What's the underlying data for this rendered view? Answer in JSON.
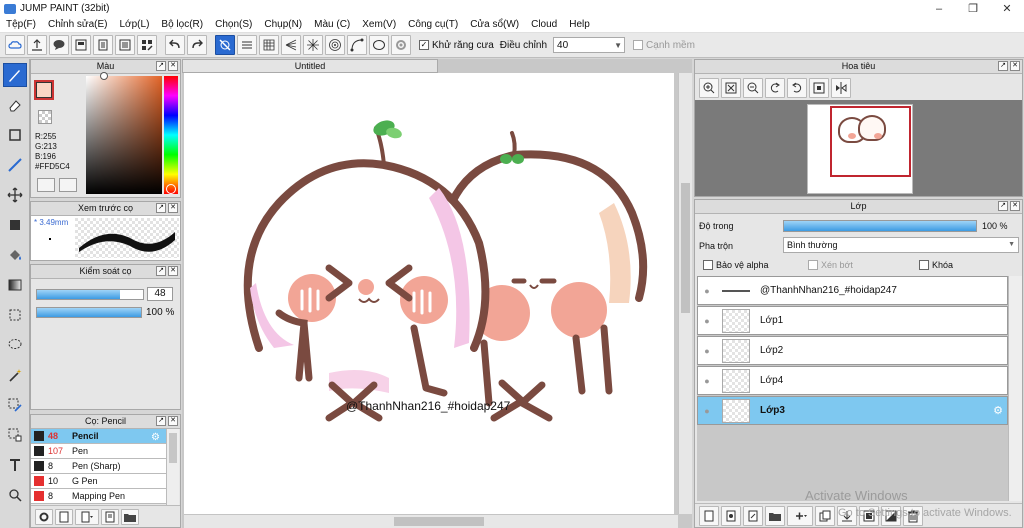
{
  "window": {
    "title": "JUMP PAINT (32bit)"
  },
  "menu": [
    "Tệp(F)",
    "Chỉnh sửa(E)",
    "Lớp(L)",
    "Bộ lọc(R)",
    "Chọn(S)",
    "Chụp(N)",
    "Màu (C)",
    "Xem(V)",
    "Công cụ(T)",
    "Cửa sổ(W)",
    "Cloud",
    "Help"
  ],
  "toolbar": {
    "antialias_label": "Khử răng cưa",
    "adjust_label": "Điều chỉnh",
    "adjust_value": "40",
    "edge_label": "Cạnh mềm"
  },
  "color_panel": {
    "title": "Màu",
    "r": "R:255",
    "g": "G:213",
    "b": "B:196",
    "hex": "#FFD5C4",
    "fg_color": "#FFD5C4",
    "bg_color": "#b34a3f"
  },
  "brush_preview": {
    "title": "Xem trước cọ",
    "size": "3.49mm"
  },
  "brush_control": {
    "title": "Kiểm soát cọ",
    "size_value": "48",
    "size_fraction": 0.78,
    "opacity_value": "100 %",
    "opacity_fraction": 1.0
  },
  "brushes": {
    "title": "Cọ: Pencil",
    "items": [
      {
        "size": "48",
        "name": "Pencil",
        "color": "#222222"
      },
      {
        "size": "107",
        "name": "Pen",
        "color": "#222222"
      },
      {
        "size": "8",
        "name": "Pen (Sharp)",
        "color": "#222222"
      },
      {
        "size": "10",
        "name": "G Pen",
        "color": "#e53030"
      },
      {
        "size": "8",
        "name": "Mapping Pen",
        "color": "#e53030"
      }
    ]
  },
  "document": {
    "tab_title": "Untitled",
    "watermark_text": "@ThanhNhan216_#hoidap247"
  },
  "navigator": {
    "title": "Hoa tiêu"
  },
  "layers": {
    "title": "Lớp",
    "opacity_label": "Độ trong",
    "opacity_value": "100 %",
    "opacity_fraction": 1.0,
    "blend_label": "Pha trộn",
    "blend_value": "Bình thường",
    "protect_alpha": "Bảo vệ alpha",
    "clipping": "Xén bớt",
    "lock": "Khóa",
    "items": [
      {
        "name": "@ThanhNhan216_#hoidap247",
        "type": "text"
      },
      {
        "name": "Lớp1",
        "type": "raster"
      },
      {
        "name": "Lớp2",
        "type": "raster"
      },
      {
        "name": "Lớp4",
        "type": "raster"
      },
      {
        "name": "Lớp3",
        "type": "raster"
      }
    ]
  },
  "system": {
    "watermark_line1": "Activate Windows",
    "watermark_line2": "Go to Settings to activate Windows."
  }
}
